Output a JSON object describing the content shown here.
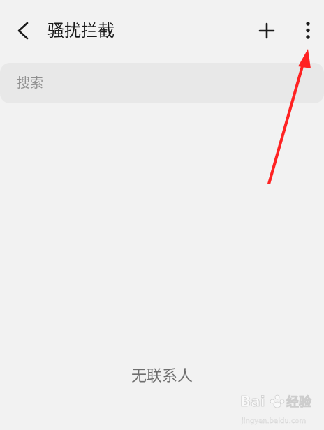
{
  "header": {
    "title": "骚扰拦截",
    "back_icon": "chevron-left-icon",
    "add_icon": "plus-icon",
    "more_icon": "more-vertical-icon"
  },
  "search": {
    "placeholder": "搜索"
  },
  "empty_state": {
    "text": "无联系人"
  },
  "annotation": {
    "color": "#ff2222"
  },
  "watermark": {
    "text": "Baidu经验",
    "url_text": "jingyan.baidu.com"
  }
}
